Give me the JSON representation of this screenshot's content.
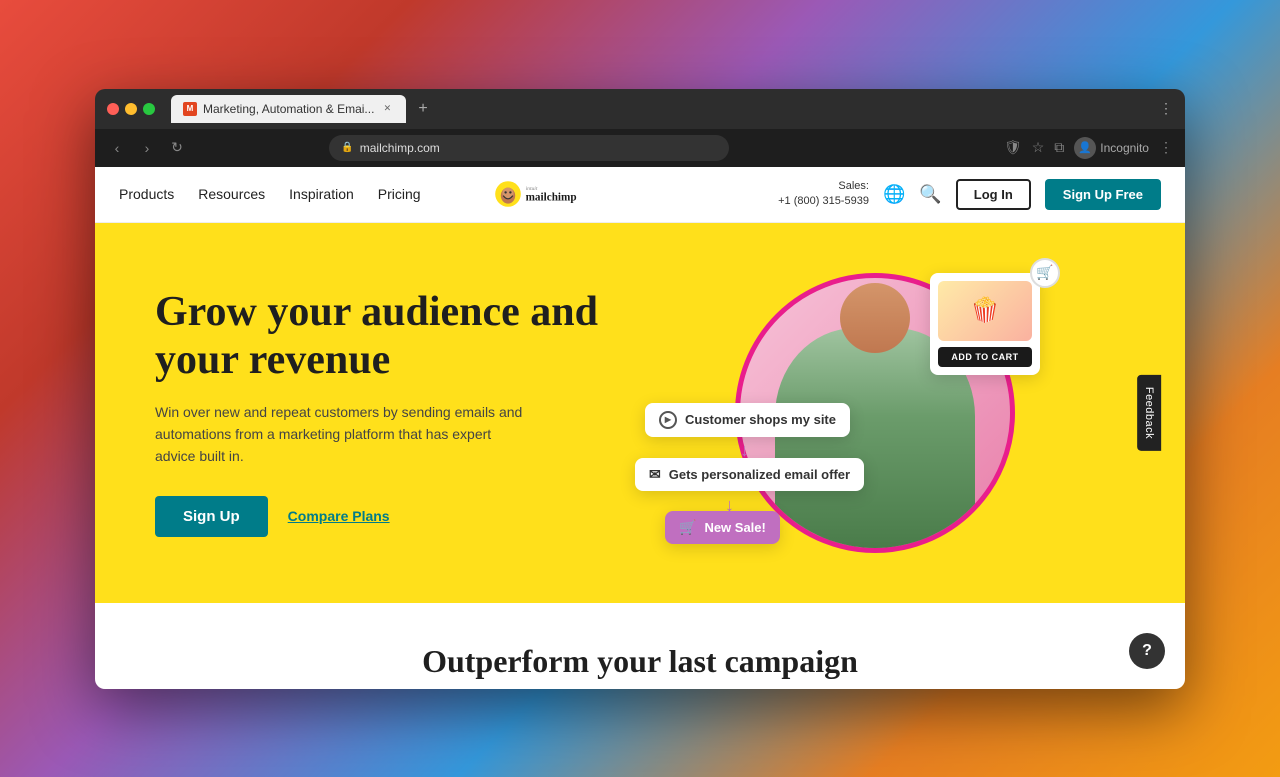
{
  "browser": {
    "tab_title": "Marketing, Automation & Emai...",
    "url": "mailchimp.com",
    "new_tab_label": "+",
    "incognito_label": "Incognito",
    "nav_back": "‹",
    "nav_forward": "›",
    "nav_reload": "↻",
    "menu_dots": "⋮"
  },
  "nav": {
    "products_label": "Products",
    "resources_label": "Resources",
    "inspiration_label": "Inspiration",
    "pricing_label": "Pricing",
    "sales_label": "Sales:",
    "sales_phone": "+1 (800) 315-5939",
    "login_label": "Log In",
    "signup_label": "Sign Up Free"
  },
  "hero": {
    "title": "Grow your audience and your revenue",
    "subtitle": "Win over new and repeat customers by sending emails and automations from a marketing platform that has expert advice built in.",
    "cta_signup": "Sign Up",
    "cta_compare": "Compare Plans",
    "flow_card_1": "Customer shops my site",
    "flow_card_2": "Gets personalized email offer",
    "flow_card_3": "New Sale!",
    "product_btn": "ADD TO CART",
    "cart_icon": "🛒",
    "email_icon": "✉",
    "play_icon": "▶"
  },
  "bottom": {
    "title": "Outperform your last campaign"
  },
  "feedback": {
    "label": "Feedback"
  },
  "help": {
    "label": "?"
  }
}
